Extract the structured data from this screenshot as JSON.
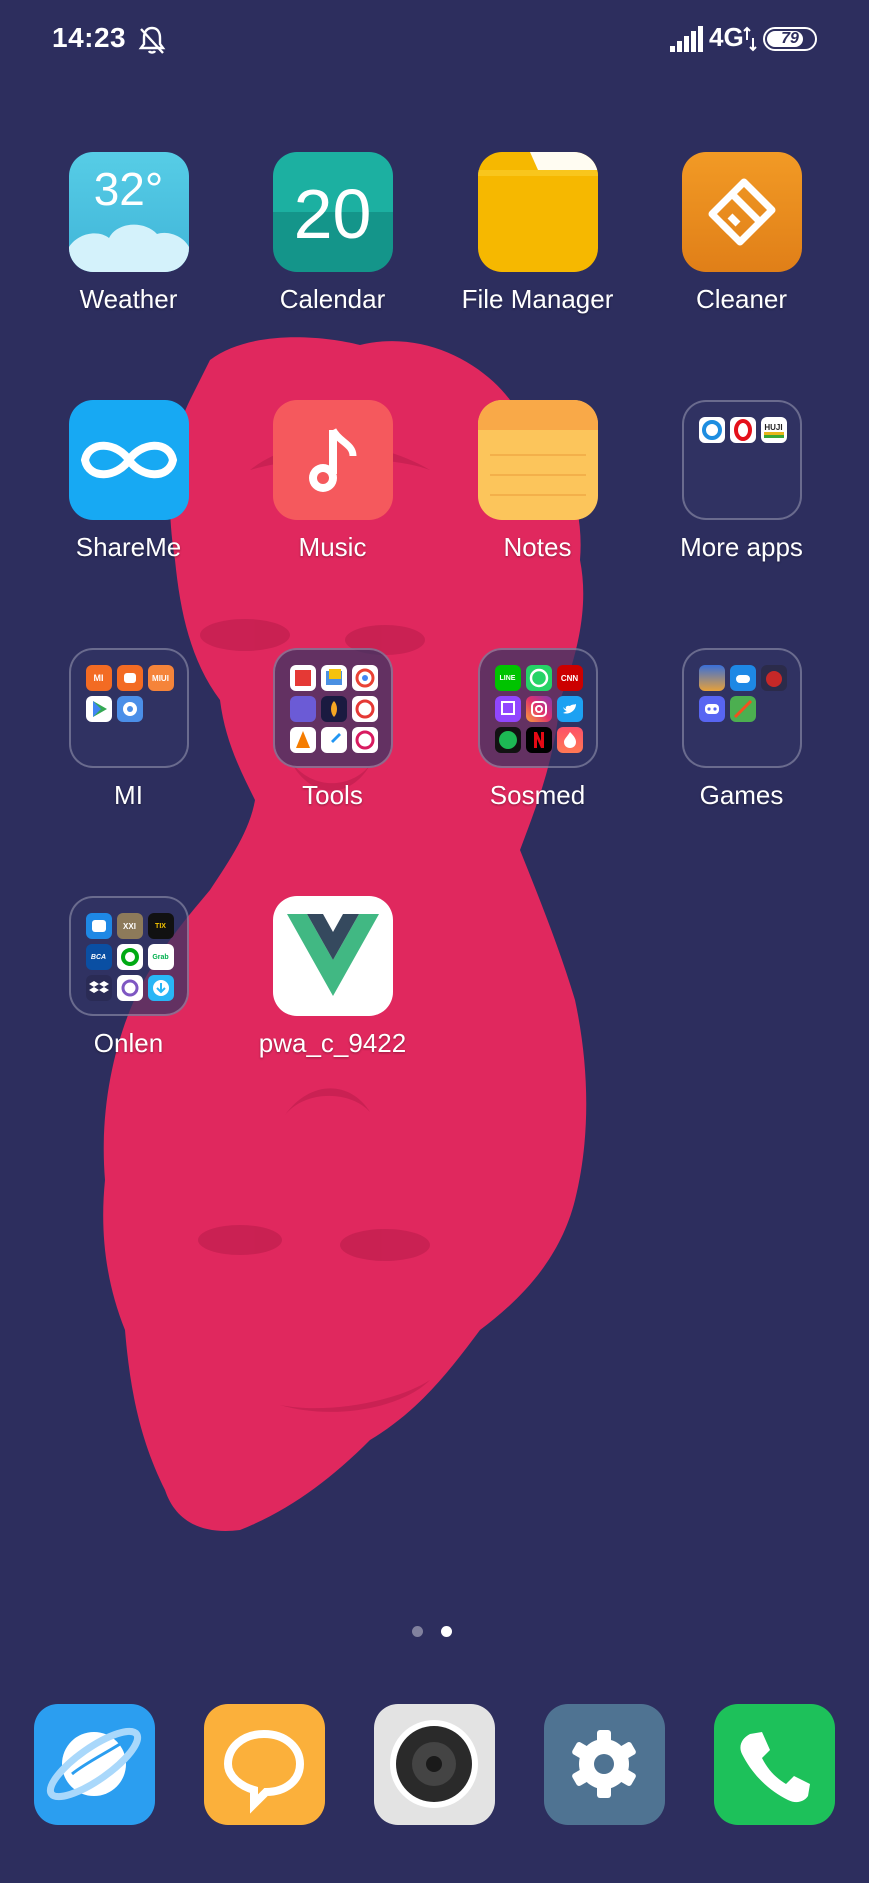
{
  "status_bar": {
    "time": "14:23",
    "network": "4G",
    "battery": "79",
    "icons": [
      "bell-off-icon",
      "signal-icon",
      "data-arrows-icon",
      "battery-icon"
    ]
  },
  "apps": [
    {
      "label": "Weather",
      "icon": "weather-icon",
      "temp": "32°"
    },
    {
      "label": "Calendar",
      "icon": "calendar-icon",
      "day": "20"
    },
    {
      "label": "File Manager",
      "icon": "folder-icon"
    },
    {
      "label": "Cleaner",
      "icon": "brush-icon"
    },
    {
      "label": "ShareMe",
      "icon": "infinity-icon"
    },
    {
      "label": "Music",
      "icon": "music-note-icon"
    },
    {
      "label": "Notes",
      "icon": "notes-icon"
    },
    {
      "label": "More apps",
      "icon": "folder-icon"
    },
    {
      "label": "MI",
      "icon": "folder-icon"
    },
    {
      "label": "Tools",
      "icon": "folder-icon"
    },
    {
      "label": "Sosmed",
      "icon": "folder-icon"
    },
    {
      "label": "Games",
      "icon": "folder-icon"
    },
    {
      "label": "Onlen",
      "icon": "folder-icon"
    },
    {
      "label": "pwa_c_9422",
      "icon": "vue-logo-icon"
    }
  ],
  "folder_minis": {
    "more_apps": [
      "HUJI"
    ],
    "mi": [
      "MI",
      "MIUI"
    ],
    "sosmed": [
      "LINE",
      "CNN"
    ],
    "onlen": [
      "XXI",
      "TIX",
      "BCA",
      "Grab"
    ]
  },
  "pages": {
    "count": 2,
    "current": 2
  },
  "dock": [
    "browser-icon",
    "messaging-icon",
    "camera-icon",
    "settings-icon",
    "phone-icon"
  ],
  "colors": {
    "background": "#2d2e5e",
    "wallpaper_statue": "#e0285e",
    "weather": "#4cc3e0",
    "calendar": "#17a193",
    "file_manager": "#f6b800",
    "cleaner": "#eb8f1f",
    "shareme": "#17a9f3",
    "music": "#f5595d",
    "notes": "#fcc55b"
  }
}
